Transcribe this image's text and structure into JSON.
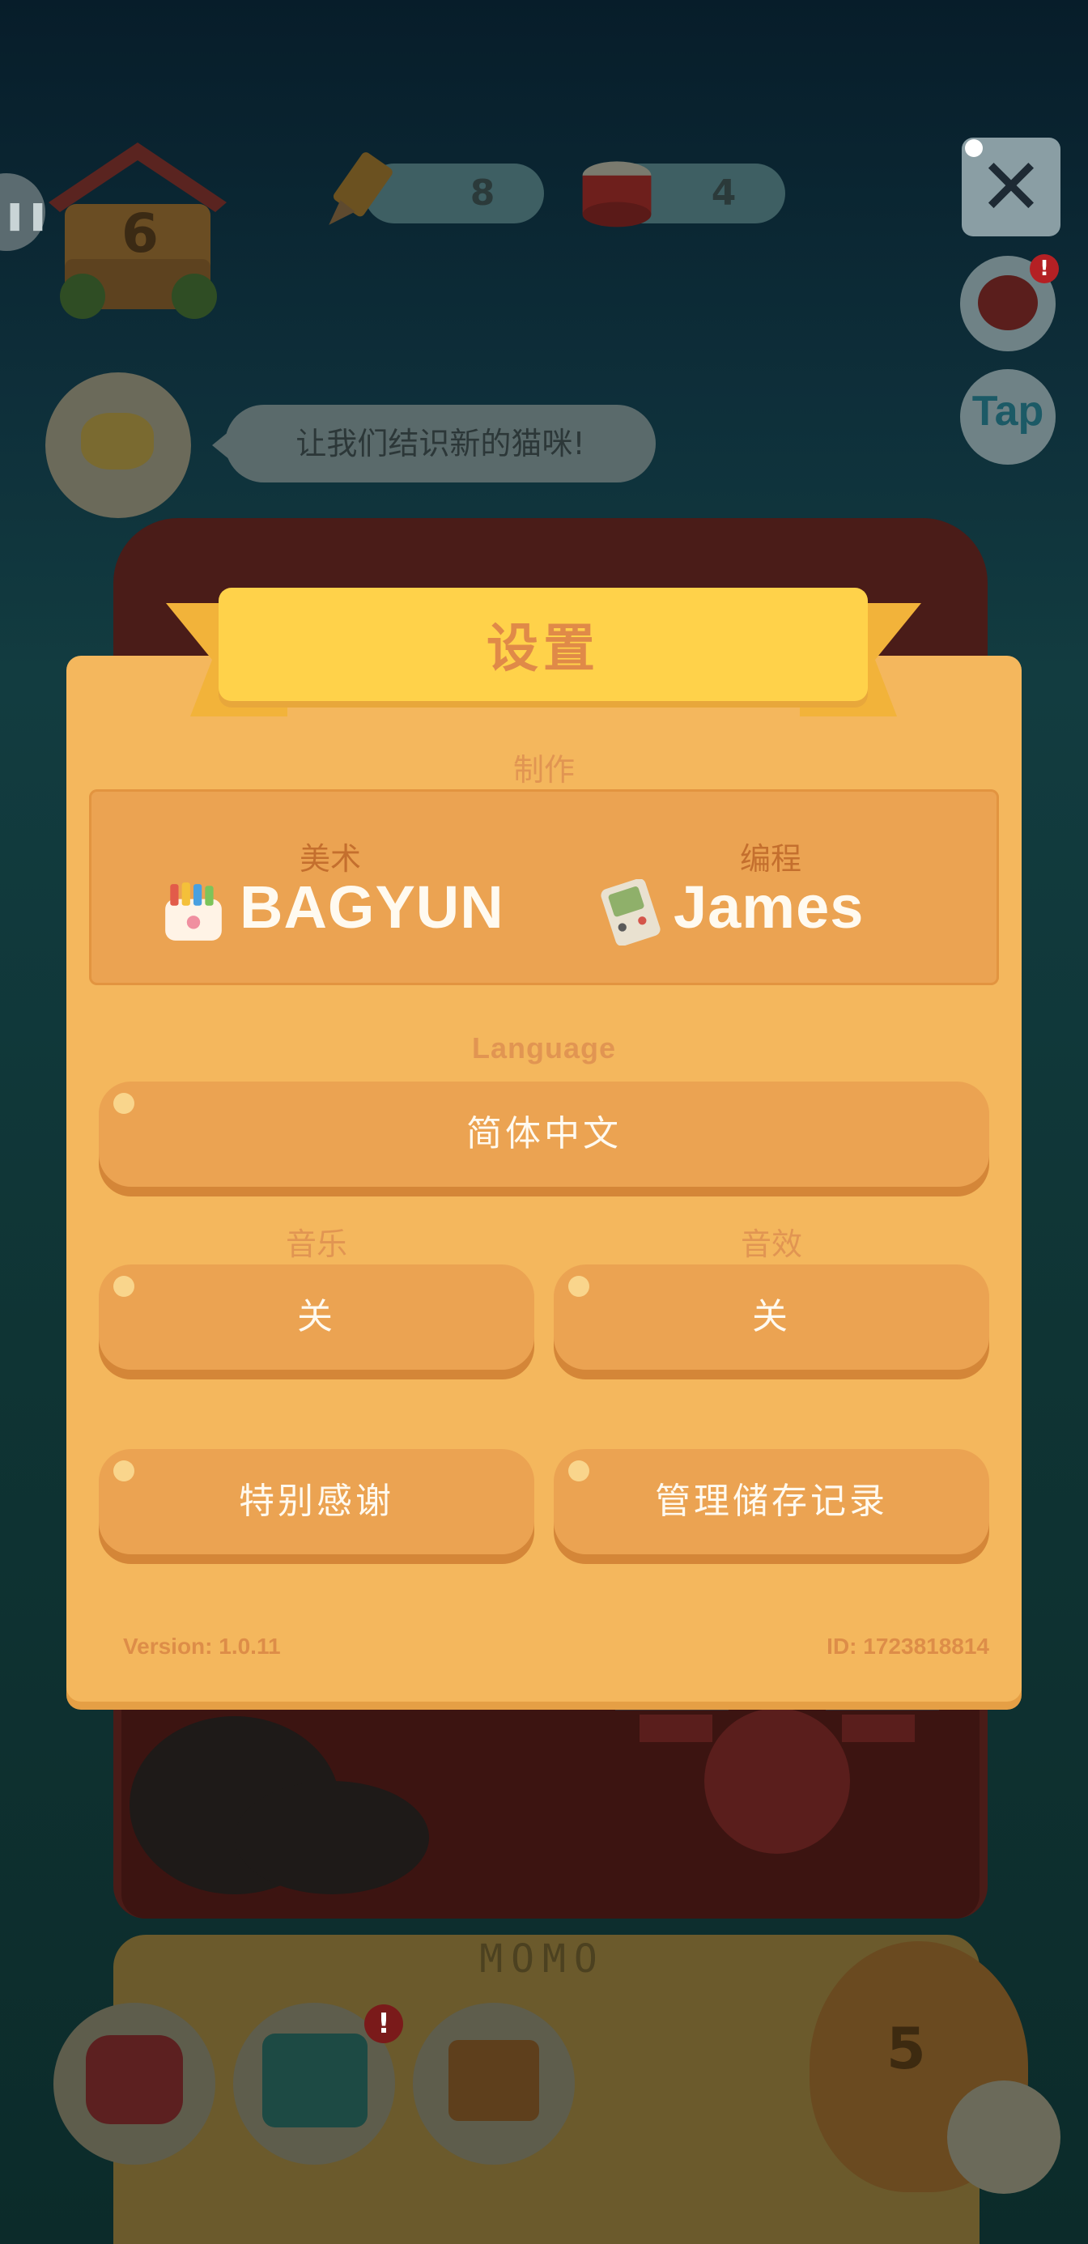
{
  "hud": {
    "house_level": "6",
    "pencils": "8",
    "cans": "4",
    "speech": "让我们结识新的猫咪!",
    "tap_label": "Tap",
    "room_name": "MOMO",
    "cat_count": "5",
    "alert_mark": "!",
    "pause_icon": "pause-icon"
  },
  "settings": {
    "title": "设置",
    "credits_label": "制作",
    "art_role": "美术",
    "art_name": "BAGYUN",
    "code_role": "编程",
    "code_name": "James",
    "language_label": "Language",
    "language_value": "简体中文",
    "music_label": "音乐",
    "music_value": "关",
    "sfx_label": "音效",
    "sfx_value": "关",
    "thanks_label": "特别感谢",
    "saves_label": "管理储存记录",
    "version": "Version: 1.0.11",
    "id": "ID: 1723818814",
    "close_icon": "close-icon"
  },
  "colors": {
    "panel": "#f4b75d",
    "ribbon": "#ffd24a",
    "button": "#eba352",
    "text_light": "#fffaf0"
  }
}
